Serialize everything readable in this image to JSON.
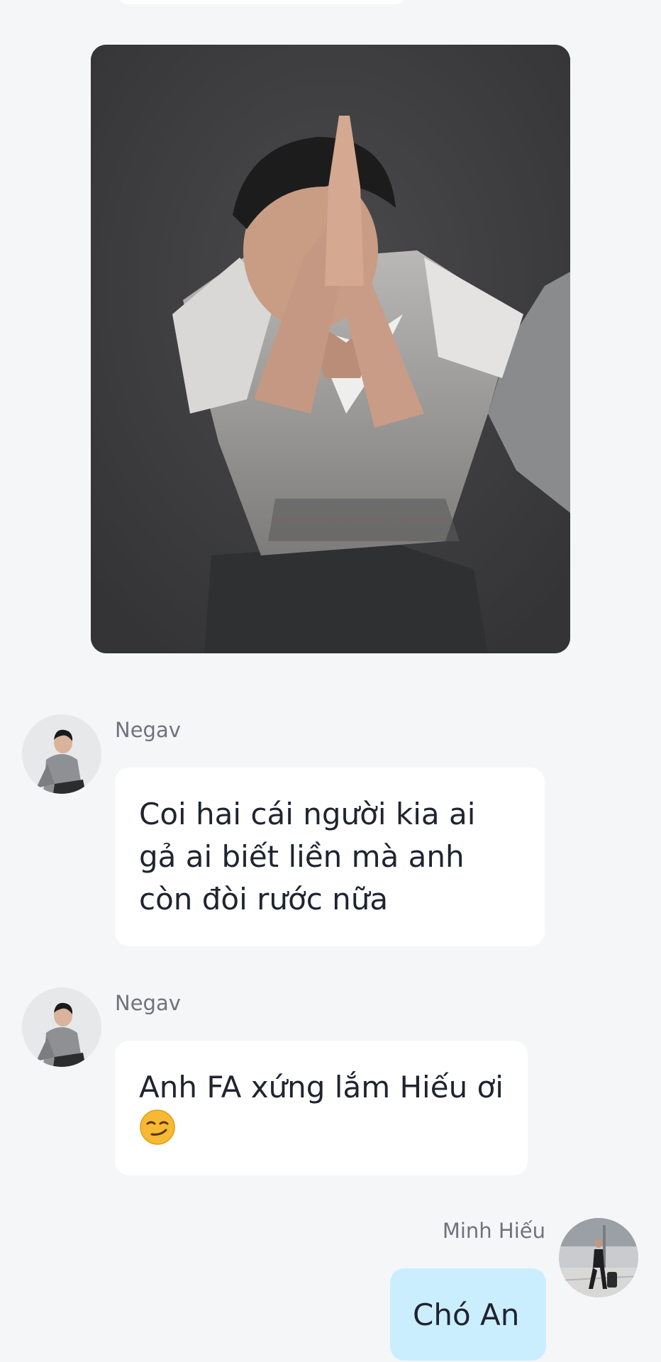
{
  "messages": [
    {
      "type": "image",
      "description_icon": "image-photo"
    },
    {
      "sender": "Negav",
      "text": "Coi hai cái người kia ai gả ai biết liền mà anh còn đòi rước nữa"
    },
    {
      "sender": "Negav",
      "text": "Anh FA xứng lắm Hiếu ơi",
      "emoji": "smirk-emoji"
    },
    {
      "sender": "Minh Hiếu",
      "text": "Chó An",
      "outgoing": true
    }
  ],
  "colors": {
    "background": "#f5f6f8",
    "incoming_bubble": "#ffffff",
    "outgoing_bubble": "#cbeeff",
    "text": "#1f2430",
    "sender_name": "#6e737c"
  }
}
